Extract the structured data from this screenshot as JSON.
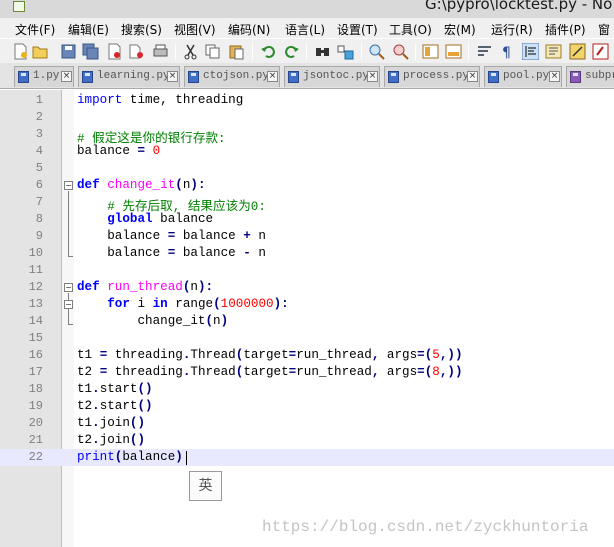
{
  "window": {
    "title": "G:\\pypro\\locktest.py - No"
  },
  "menubar": {
    "items": [
      {
        "label": "文件(F)"
      },
      {
        "label": "编辑(E)"
      },
      {
        "label": "搜索(S)"
      },
      {
        "label": "视图(V)"
      },
      {
        "label": "编码(N)"
      },
      {
        "label": "语言(L)"
      },
      {
        "label": "设置(T)"
      },
      {
        "label": "工具(O)"
      },
      {
        "label": "宏(M)"
      },
      {
        "label": "运行(R)"
      },
      {
        "label": "插件(P)"
      },
      {
        "label": "窗"
      }
    ]
  },
  "toolbar": {
    "icons": [
      "new-file-icon",
      "open-file-icon",
      "save-icon",
      "save-all-icon",
      "close-icon",
      "close-all-icon",
      "print-icon",
      "cut-icon",
      "copy-icon",
      "paste-icon",
      "undo-icon",
      "redo-icon",
      "find-icon",
      "replace-icon",
      "zoom-in-icon",
      "zoom-out-icon",
      "sync-v-icon",
      "sync-h-icon",
      "word-wrap-icon",
      "show-all-chars-icon",
      "indent-guide-icon",
      "doc-map-icon",
      "function-list-icon",
      "folder-workspace-icon"
    ]
  },
  "tabs": [
    {
      "label": "1.py"
    },
    {
      "label": "learning.py"
    },
    {
      "label": "ctojson.py"
    },
    {
      "label": "jsontoc.py"
    },
    {
      "label": "process.py"
    },
    {
      "label": "pool.py"
    },
    {
      "label": "subpr"
    }
  ],
  "editor": {
    "lines": [
      {
        "no": "1",
        "code": "import time, threading"
      },
      {
        "no": "2",
        "code": ""
      },
      {
        "no": "3",
        "code": "# 假定这是你的银行存款:"
      },
      {
        "no": "4",
        "code": "balance = 0"
      },
      {
        "no": "5",
        "code": ""
      },
      {
        "no": "6",
        "code": "def change_it(n):"
      },
      {
        "no": "7",
        "code": "    # 先存后取, 结果应该为0:"
      },
      {
        "no": "8",
        "code": "    global balance"
      },
      {
        "no": "9",
        "code": "    balance = balance + n"
      },
      {
        "no": "10",
        "code": "    balance = balance - n"
      },
      {
        "no": "11",
        "code": ""
      },
      {
        "no": "12",
        "code": "def run_thread(n):"
      },
      {
        "no": "13",
        "code": "    for i in range(1000000):"
      },
      {
        "no": "14",
        "code": "        change_it(n)"
      },
      {
        "no": "15",
        "code": ""
      },
      {
        "no": "16",
        "code": "t1 = threading.Thread(target=run_thread, args=(5,))"
      },
      {
        "no": "17",
        "code": "t2 = threading.Thread(target=run_thread, args=(8,))"
      },
      {
        "no": "18",
        "code": "t1.start()"
      },
      {
        "no": "19",
        "code": "t2.start()"
      },
      {
        "no": "20",
        "code": "t1.join()"
      },
      {
        "no": "21",
        "code": "t2.join()"
      },
      {
        "no": "22",
        "code": "print(balance)"
      }
    ]
  },
  "ime_indicator": "英",
  "watermark": "https://blog.csdn.net/zyckhuntoria",
  "colors": {
    "keyword": "#0000ff",
    "function_name": "#ff00ff",
    "number": "#ff0000",
    "comment": "#008000",
    "operator": "#000080",
    "current_line": "#e8e8ff"
  }
}
